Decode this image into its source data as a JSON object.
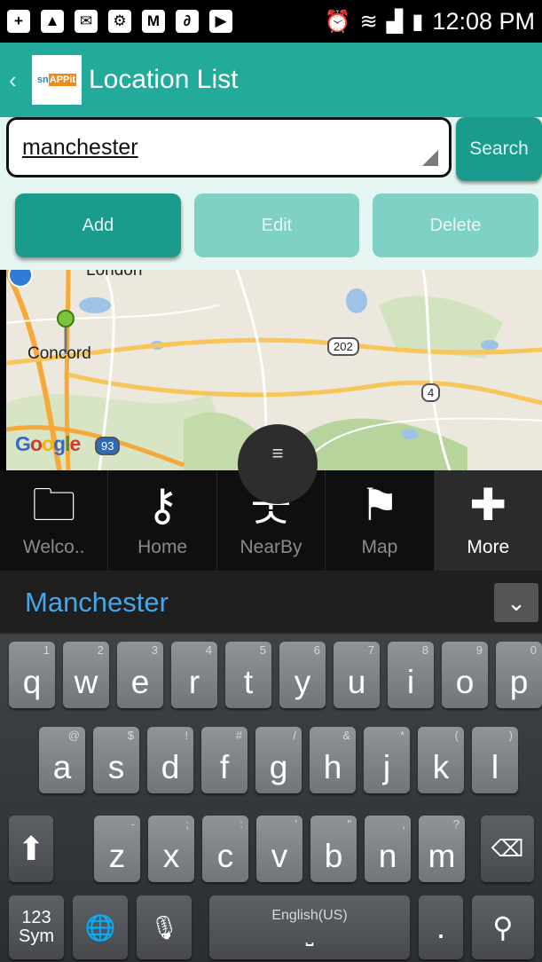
{
  "status_bar": {
    "time": "12:08 PM",
    "left_icons": [
      "plus-square-icon",
      "image-icon",
      "message-icon",
      "settings-icon",
      "gmail-icon",
      "attachment-icon",
      "youtube-icon"
    ],
    "right_icons": [
      "alarm-icon",
      "wifi-icon",
      "signal-icon",
      "battery-icon"
    ]
  },
  "action_bar": {
    "title": "Location List",
    "logo_text_a": "sn",
    "logo_text_b": "APPit"
  },
  "search": {
    "value": "manchester",
    "button_label": "Search"
  },
  "actions": {
    "add_label": "Add",
    "edit_label": "Edit",
    "delete_label": "Delete"
  },
  "map": {
    "places": [
      "Concord",
      "London"
    ],
    "routes": [
      "202",
      "4",
      "93"
    ],
    "attribution": "Google"
  },
  "tabs": [
    {
      "label": "Welco..",
      "icon": "folder-icon"
    },
    {
      "label": "Home",
      "icon": "key-icon"
    },
    {
      "label": "NearBy",
      "icon": "walking-person-icon"
    },
    {
      "label": "Map",
      "icon": "map-pin-icon"
    },
    {
      "label": "More",
      "icon": "plus-icon",
      "selected": true
    }
  ],
  "suggestion": {
    "text": "Manchester"
  },
  "keyboard": {
    "row1": [
      [
        "q",
        "1"
      ],
      [
        "w",
        "2"
      ],
      [
        "e",
        "3"
      ],
      [
        "r",
        "4"
      ],
      [
        "t",
        "5"
      ],
      [
        "y",
        "6"
      ],
      [
        "u",
        "7"
      ],
      [
        "i",
        "8"
      ],
      [
        "o",
        "9"
      ],
      [
        "p",
        "0"
      ]
    ],
    "row2": [
      [
        "a",
        "@"
      ],
      [
        "s",
        "$"
      ],
      [
        "d",
        "!"
      ],
      [
        "f",
        "#"
      ],
      [
        "g",
        "/"
      ],
      [
        "h",
        "&"
      ],
      [
        "j",
        "*"
      ],
      [
        "k",
        "("
      ],
      [
        "l",
        ")"
      ]
    ],
    "row3": [
      [
        "z",
        "-"
      ],
      [
        "x",
        ";"
      ],
      [
        "c",
        ":"
      ],
      [
        "v",
        "'"
      ],
      [
        "b",
        "\""
      ],
      [
        "n",
        ","
      ],
      [
        "m",
        "?"
      ]
    ],
    "sym_label_1": "123",
    "sym_label_2": "Sym",
    "space_label": "English(US)",
    "period": "."
  }
}
